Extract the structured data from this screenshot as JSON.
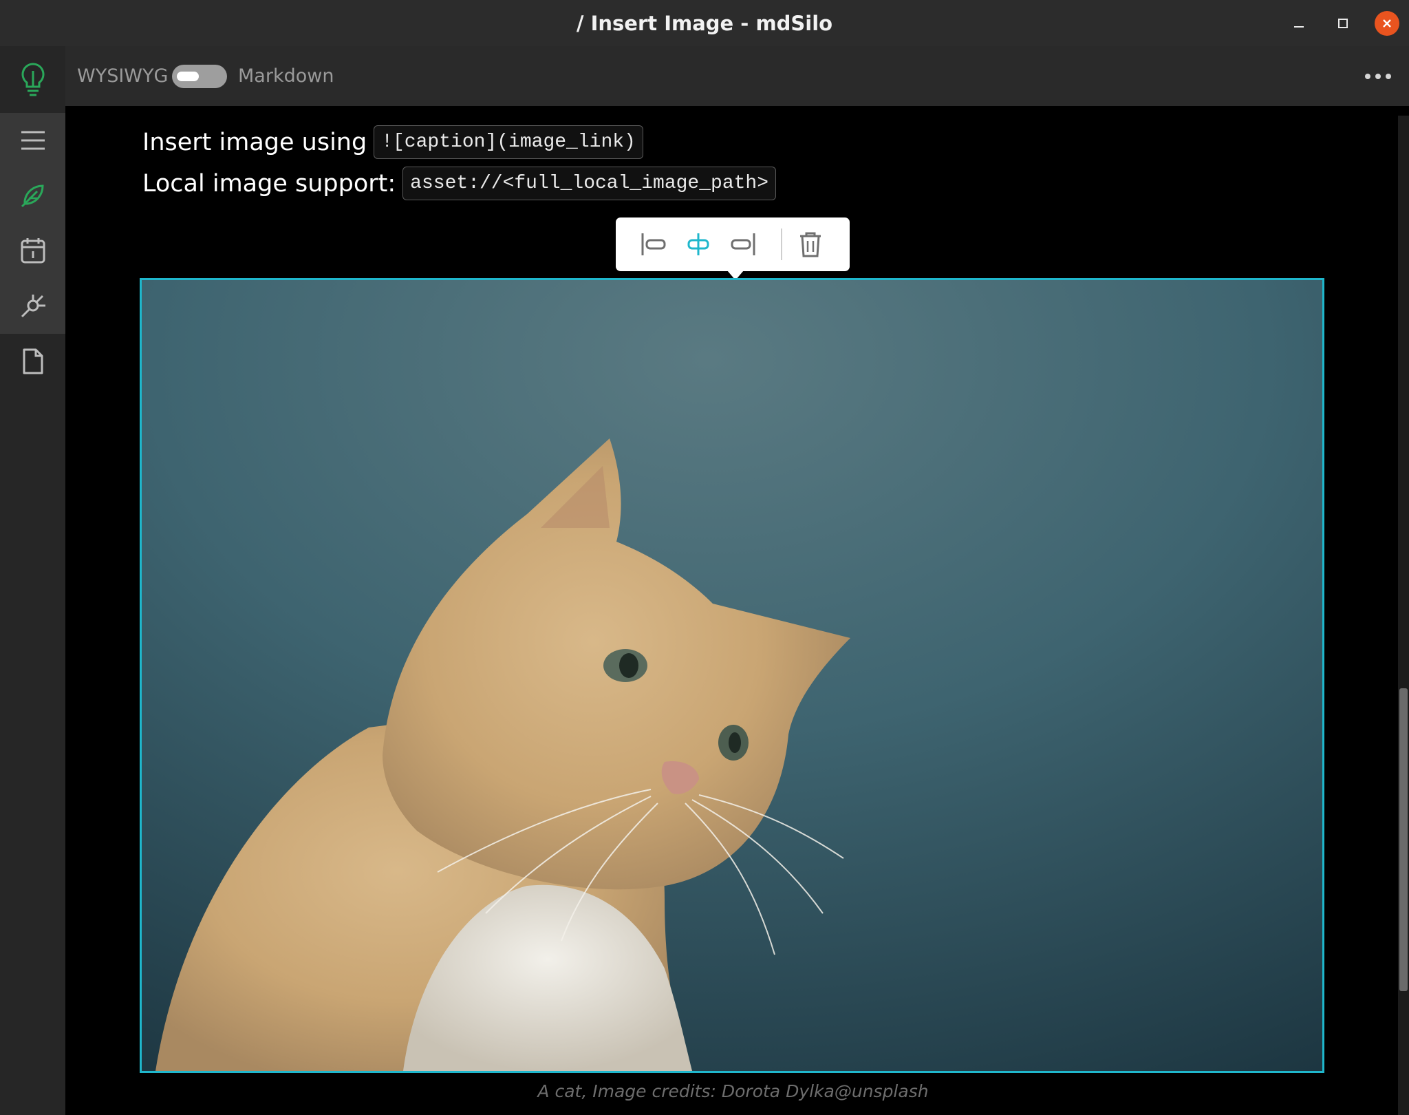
{
  "window": {
    "title": "/ Insert Image - mdSilo",
    "controls": [
      "minimize-icon",
      "maximize-icon",
      "close-icon"
    ],
    "close_color": "#e9541f"
  },
  "sidebar": {
    "logo": "lightbulb-icon",
    "items": [
      {
        "icon": "menu-icon",
        "active": false
      },
      {
        "icon": "feather-icon",
        "active": true
      },
      {
        "icon": "calendar-icon",
        "active": false
      },
      {
        "icon": "graph-icon",
        "active": false
      },
      {
        "icon": "file-icon",
        "active": false
      }
    ],
    "accent": "#2aa85a"
  },
  "toolbar": {
    "left_label": "WYSIWYG",
    "right_label": "Markdown",
    "more_icon": "more-horizontal-icon"
  },
  "content": {
    "line1_text": "Insert image using",
    "line1_code": "![caption](image_link)",
    "line2_text": "Local image support:",
    "line2_code": "asset://<full_local_image_path>"
  },
  "image_toolbar": {
    "buttons": [
      "align-left-icon",
      "align-center-icon",
      "align-right-icon",
      "trash-icon"
    ],
    "active": "align-center-icon",
    "active_color": "#1fb7cc"
  },
  "image": {
    "caption": "A cat, Image credits: Dorota Dylka@unsplash",
    "border_color": "#1fb7cc"
  }
}
